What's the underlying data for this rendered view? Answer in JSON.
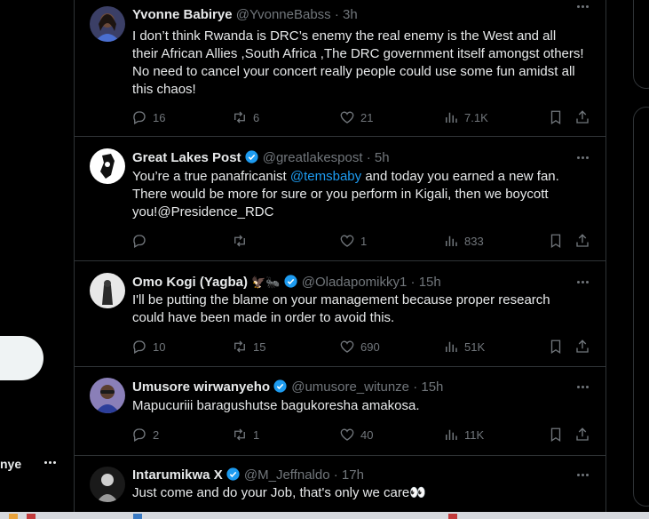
{
  "left": {
    "account_name_partial": "nye"
  },
  "tweets": [
    {
      "name": "Yvonne Babirye",
      "verified": false,
      "handle": "@YvonneBabss",
      "time": "3h",
      "text": "I don’t think Rwanda is DRC’s enemy the real enemy is the West and all their African Allies ,South Africa ,The DRC government itself amongst others! No need to cancel your concert really people could use some fun amidst all this chaos!",
      "replies": "16",
      "retweets": "6",
      "likes": "21",
      "views": "7.1K"
    },
    {
      "name": "Great Lakes Post",
      "verified": true,
      "handle": "@greatlakespost",
      "time": "5h",
      "text_before": "You’re a true panafricanist ",
      "mention": "@temsbaby",
      "text_after": " and today you earned a new fan. There would be more for sure or you perform in Kigali, then we boycott you!@Presidence_RDC",
      "replies": "",
      "retweets": "",
      "likes": "1",
      "views": "833"
    },
    {
      "name": "Omo Kogi (Yagba)",
      "name_emoji": "🦅🐜",
      "verified": true,
      "handle": "@Oladapomikky1",
      "time": "15h",
      "text": "I'll be putting the blame on your management because proper research could have been made in order to avoid this.",
      "replies": "10",
      "retweets": "15",
      "likes": "690",
      "views": "51K"
    },
    {
      "name": "Umusore wirwanyeho",
      "verified": true,
      "handle": "@umusore_witunze",
      "time": "15h",
      "text": "Mapucuriii baragushutse bagukoresha amakosa.",
      "replies": "2",
      "retweets": "1",
      "likes": "40",
      "views": "11K"
    },
    {
      "name": "Intarumikwa X",
      "verified": true,
      "handle": "@M_Jeffnaldo",
      "time": "17h",
      "text": "Just come and do your Job, that's only we care👀"
    }
  ],
  "colors": {
    "background": "#000000",
    "border": "#2f3336",
    "text": "#e7e9ea",
    "muted": "#71767b",
    "link": "#1d9bf0",
    "verified": "#1d9bf0"
  },
  "icons": {
    "reply": "reply-icon",
    "retweet": "retweet-icon",
    "like": "heart-icon",
    "views": "views-icon",
    "bookmark": "bookmark-icon",
    "share": "share-icon",
    "verified": "verified-badge-icon",
    "more": "more-icon"
  }
}
